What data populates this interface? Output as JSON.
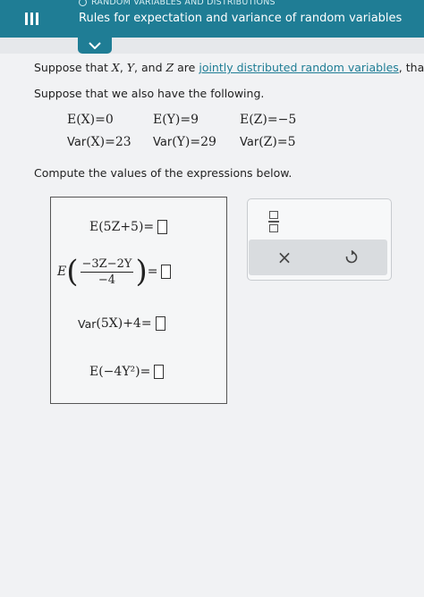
{
  "header": {
    "topic": "RANDOM VARIABLES AND DISTRIBUTIONS",
    "title": "Rules for expectation and variance of random variables"
  },
  "problem": {
    "intro_prefix": "Suppose that ",
    "var_x": "X",
    "comma1": ", ",
    "var_y": "Y",
    "and_text": ", and ",
    "var_z": "Z",
    "are_text": " are ",
    "link_text": "jointly distributed random variables",
    "intro_suffix": ", tha",
    "followup": "Suppose that we also have the following.",
    "stats": {
      "ex": "E(X)=0",
      "ey": "E(Y)=9",
      "ez": "E(Z)=−5",
      "var_prefix": "Var",
      "varx": "(X)=23",
      "vary": "(Y)=29",
      "varz": "(Z)=5"
    },
    "compute": "Compute the values of the expressions below."
  },
  "expressions": {
    "e1": "E(5Z+5)=",
    "e2_prefix": "E",
    "e2_num": "−3Z−2Y",
    "e2_den": "−4",
    "e2_eq": "=",
    "e3_prefix": "Var",
    "e3_rest": "(5X)+4=",
    "e4": "E(−4Y²)="
  },
  "tools": {
    "x_symbol": "×"
  }
}
